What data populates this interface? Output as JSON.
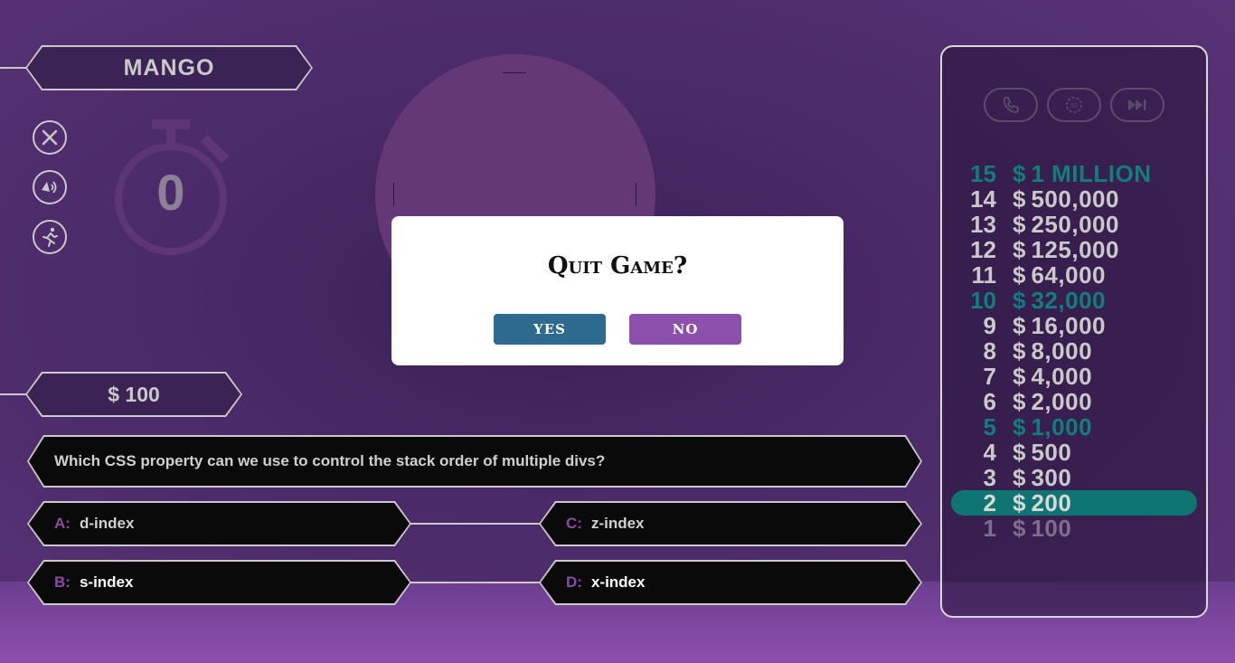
{
  "player": {
    "name": "MANGO"
  },
  "timer": {
    "value": "0"
  },
  "current_prize": {
    "label": "$ 100"
  },
  "question": {
    "text": "Which CSS property can we use to control the stack order of multiple divs?"
  },
  "answers": [
    {
      "letter": "A:",
      "text": "d-index"
    },
    {
      "letter": "B:",
      "text": "s-index"
    },
    {
      "letter": "C:",
      "text": "z-index"
    },
    {
      "letter": "D:",
      "text": "x-index"
    }
  ],
  "side_buttons": [
    "close-icon",
    "sound-icon",
    "running-man-icon"
  ],
  "lifelines": [
    "phone-icon",
    "fifty-fifty-icon",
    "skip-icon"
  ],
  "ladder": [
    {
      "num": "15",
      "sym": "$",
      "amt": "1 MILLION",
      "state": "milestone"
    },
    {
      "num": "14",
      "sym": "$",
      "amt": "500,000",
      "state": "normal"
    },
    {
      "num": "13",
      "sym": "$",
      "amt": "250,000",
      "state": "normal"
    },
    {
      "num": "12",
      "sym": "$",
      "amt": "125,000",
      "state": "normal"
    },
    {
      "num": "11",
      "sym": "$",
      "amt": "64,000",
      "state": "normal"
    },
    {
      "num": "10",
      "sym": "$",
      "amt": "32,000",
      "state": "milestone"
    },
    {
      "num": "9",
      "sym": "$",
      "amt": "16,000",
      "state": "normal"
    },
    {
      "num": "8",
      "sym": "$",
      "amt": "8,000",
      "state": "normal"
    },
    {
      "num": "7",
      "sym": "$",
      "amt": "4,000",
      "state": "normal"
    },
    {
      "num": "6",
      "sym": "$",
      "amt": "2,000",
      "state": "normal"
    },
    {
      "num": "5",
      "sym": "$",
      "amt": "1,000",
      "state": "milestone"
    },
    {
      "num": "4",
      "sym": "$",
      "amt": "500",
      "state": "normal"
    },
    {
      "num": "3",
      "sym": "$",
      "amt": "300",
      "state": "normal"
    },
    {
      "num": "2",
      "sym": "$",
      "amt": "200",
      "state": "current"
    },
    {
      "num": "1",
      "sym": "$",
      "amt": "100",
      "state": "past"
    }
  ],
  "modal": {
    "title": "Quit Game?",
    "yes_label": "YES",
    "no_label": "NO",
    "yes_color": "#2e6a8e",
    "no_color": "#8c4fab"
  },
  "colors": {
    "milestone": "#0f7f7a",
    "current": "#0f7572",
    "answer_letter": "#8a4ba8"
  }
}
